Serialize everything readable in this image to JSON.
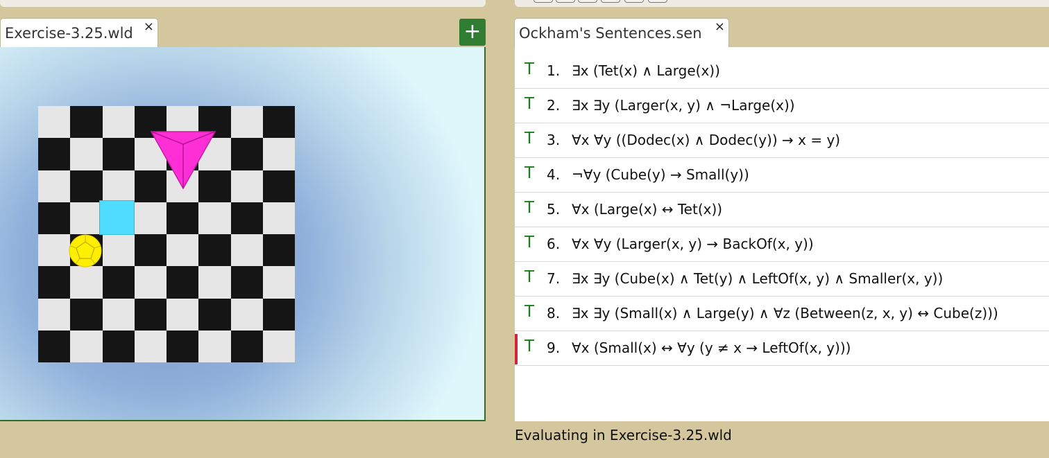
{
  "world_tab": {
    "label": "Exercise-3.25.wld",
    "close": "×"
  },
  "add_button": {
    "label": "+"
  },
  "sentences_tab": {
    "label": "Ockham's Sentences.sen",
    "close": "×"
  },
  "sentences": [
    {
      "truth": "T",
      "num": "1.",
      "text": "∃x (Tet(x) ∧ Large(x))"
    },
    {
      "truth": "T",
      "num": "2.",
      "text": "∃x ∃y (Larger(x, y) ∧ ¬Large(x))"
    },
    {
      "truth": "T",
      "num": "3.",
      "text": "∀x ∀y ((Dodec(x) ∧ Dodec(y)) → x = y)"
    },
    {
      "truth": "T",
      "num": "4.",
      "text": "¬∀y (Cube(y) → Small(y))"
    },
    {
      "truth": "T",
      "num": "5.",
      "text": "∀x (Large(x) ↔ Tet(x))"
    },
    {
      "truth": "T",
      "num": "6.",
      "text": "∀x ∀y (Larger(x, y) → BackOf(x, y))"
    },
    {
      "truth": "T",
      "num": "7.",
      "text": "∃x ∃y (Cube(x) ∧ Tet(y) ∧ LeftOf(x, y) ∧ Smaller(x, y))"
    },
    {
      "truth": "T",
      "num": "8.",
      "text": "∃x ∃y (Small(x) ∧ Large(y) ∧ ∀z (Between(z, x, y) ↔ Cube(z)))"
    },
    {
      "truth": "T",
      "num": "9.",
      "text": "∀x (Small(x) ↔ ∀y (y ≠ x → LeftOf(x, y)))"
    }
  ],
  "selected_sentence": 9,
  "status": "Evaluating in Exercise-3.25.wld",
  "colors": {
    "truth_true": "#1b7a1b",
    "selection": "#d0243b",
    "tet": "#ff2fd6",
    "cube": "#4fdcff",
    "dodec": "#ffee00",
    "add_button": "#2e7d32"
  }
}
